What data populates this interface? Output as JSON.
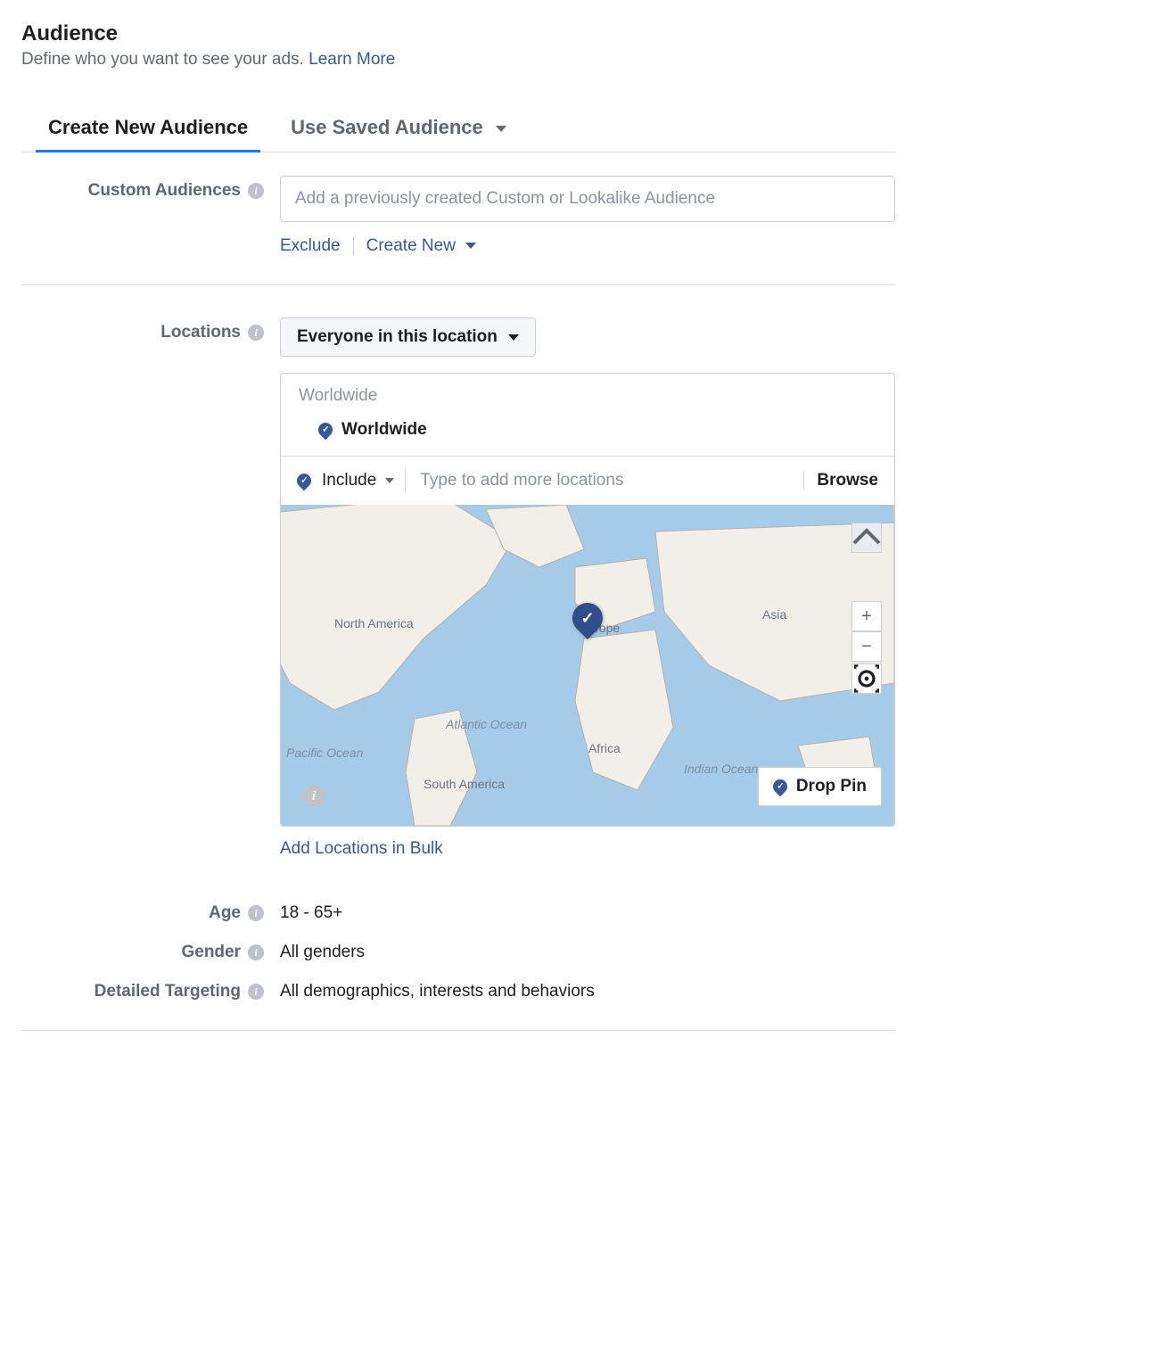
{
  "header": {
    "title": "Audience",
    "subtitle": "Define who you want to see your ads.",
    "learn_more": "Learn More"
  },
  "tabs": {
    "create": "Create New Audience",
    "saved": "Use Saved Audience"
  },
  "custom_audiences": {
    "label": "Custom Audiences",
    "placeholder": "Add a previously created Custom or Lookalike Audience",
    "exclude": "Exclude",
    "create_new": "Create New"
  },
  "locations": {
    "label": "Locations",
    "scope_selected": "Everyone in this location",
    "group": "Worldwide",
    "item": "Worldwide",
    "include": "Include",
    "search_placeholder": "Type to add more locations",
    "browse": "Browse",
    "add_bulk": "Add Locations in Bulk",
    "drop_pin": "Drop Pin",
    "map_labels": {
      "north_america": "North America",
      "europe": "Europe",
      "asia": "Asia",
      "africa": "Africa",
      "south_america": "South America",
      "atlantic_ocean": "Atlantic Ocean",
      "pacific_ocean": "Pacific Ocean",
      "indian_ocean": "Indian Ocean"
    }
  },
  "age": {
    "label": "Age",
    "value": "18 - 65+"
  },
  "gender": {
    "label": "Gender",
    "value": "All genders"
  },
  "detailed": {
    "label": "Detailed Targeting",
    "value": "All demographics, interests and behaviors"
  }
}
